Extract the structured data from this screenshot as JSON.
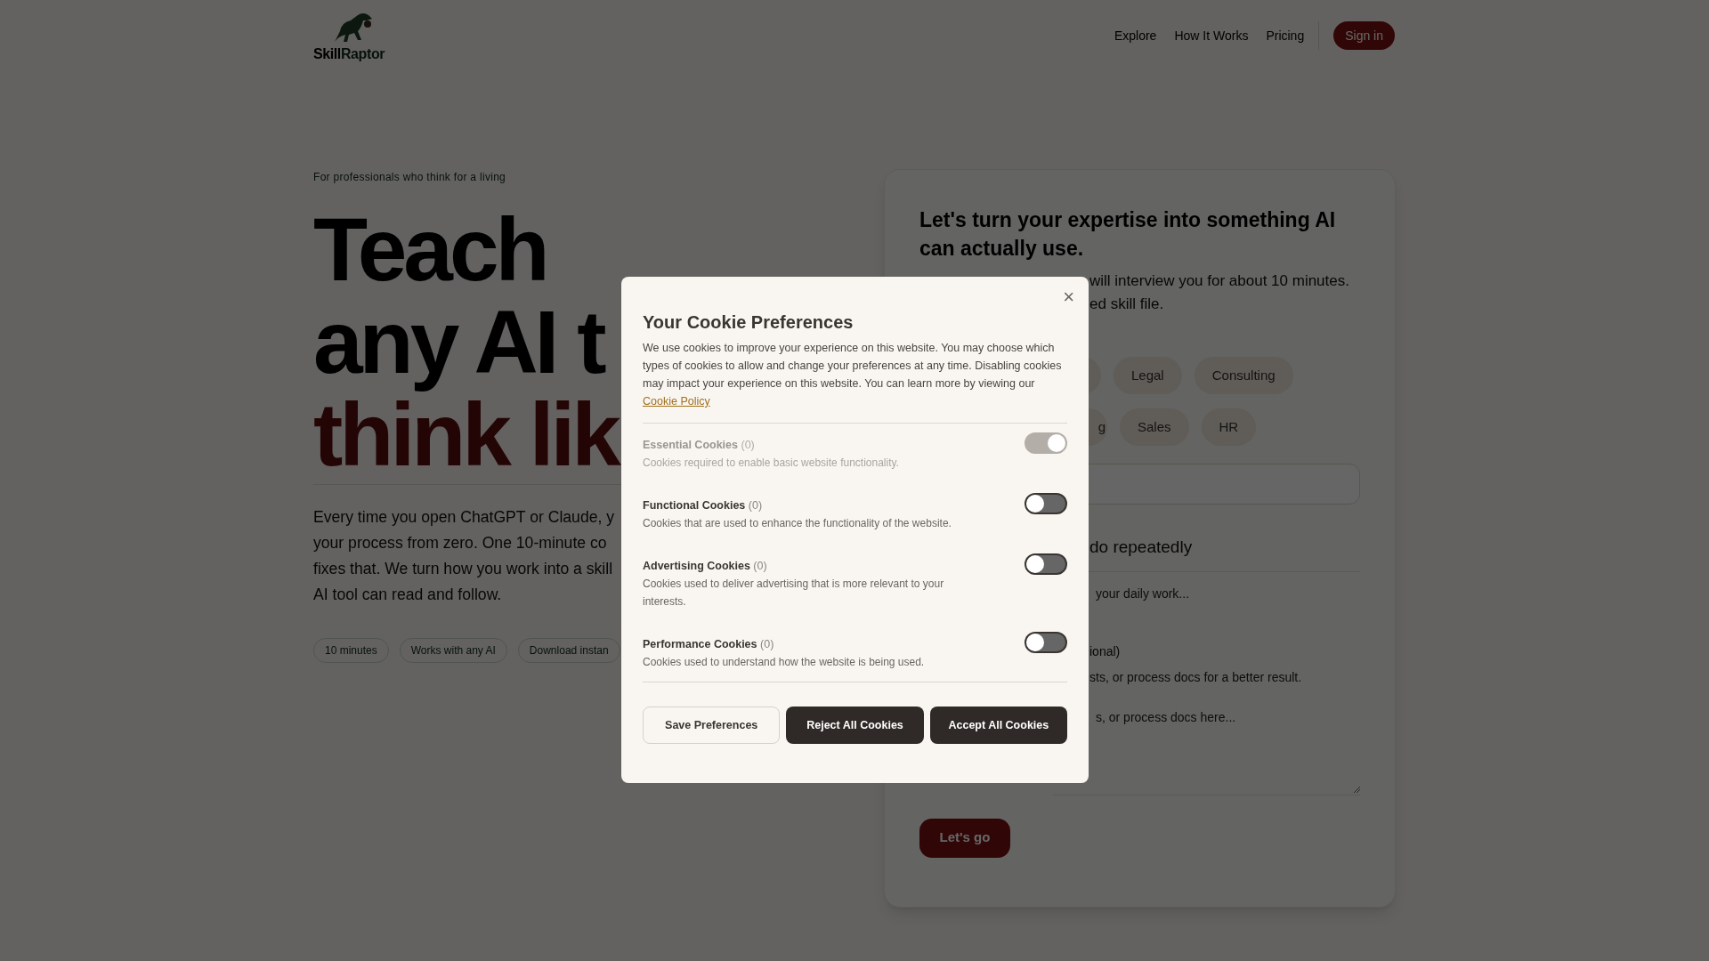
{
  "header": {
    "logo_text": "Skill",
    "logo_text_accent": "Raptor",
    "nav": [
      "Explore",
      "How It Works",
      "Pricing"
    ],
    "sign_in": "Sign in"
  },
  "hero": {
    "eyebrow": "For professionals who think for a living",
    "headline": [
      "Teach",
      "any AI t",
      "think lik"
    ],
    "paragraph": [
      "Every time you open ChatGPT or Claude, y",
      "your process from zero. One 10-minute co",
      "fixes that. We turn how you work into a skill",
      "AI tool can read and follow."
    ],
    "chips": [
      "10 minutes",
      "Works with any AI",
      "Download instan"
    ]
  },
  "card": {
    "title": "Let's turn your expertise into something AI can actually use.",
    "intro": [
      "will interview you for about 10 minutes.",
      "ed skill file."
    ],
    "tag_rows": [
      [
        "",
        "Legal",
        "Consulting"
      ],
      [
        "g",
        "Sales",
        "HR"
      ]
    ],
    "question": "do repeatedly",
    "task_placeholder": "your daily work...",
    "optional_label": "ional)",
    "optional_hint": "sts, or process docs for a better result.",
    "docs_placeholder": "s, or process docs here...",
    "submit": "Let's go"
  },
  "cookie_modal": {
    "title": "Your Cookie Preferences",
    "body": "We use cookies to improve your experience on this website. You may choose which types of cookies to allow and change your preferences at any time. Disabling cookies may impact your experience on this website. You can learn more by viewing our",
    "link": "Cookie Policy",
    "close": "×",
    "categories": [
      {
        "name": "Essential Cookies",
        "count": "(0)",
        "description": "Cookies required to enable basic website functionality.",
        "on": true,
        "disabled": true
      },
      {
        "name": "Functional Cookies",
        "count": "(0)",
        "description": "Cookies that are used to enhance the functionality of the website.",
        "on": false,
        "disabled": false
      },
      {
        "name": "Advertising Cookies",
        "count": "(0)",
        "description": "Cookies used to deliver advertising that is more relevant to your interests.",
        "on": false,
        "disabled": false
      },
      {
        "name": "Performance Cookies",
        "count": "(0)",
        "description": "Cookies used to understand how the website is being used.",
        "on": false,
        "disabled": false
      }
    ],
    "buttons": [
      {
        "label": "Save Preferences",
        "kind": "outline"
      },
      {
        "label": "Reject All Cookies",
        "kind": "solid"
      },
      {
        "label": "Accept All Cookies",
        "kind": "solid"
      }
    ]
  }
}
